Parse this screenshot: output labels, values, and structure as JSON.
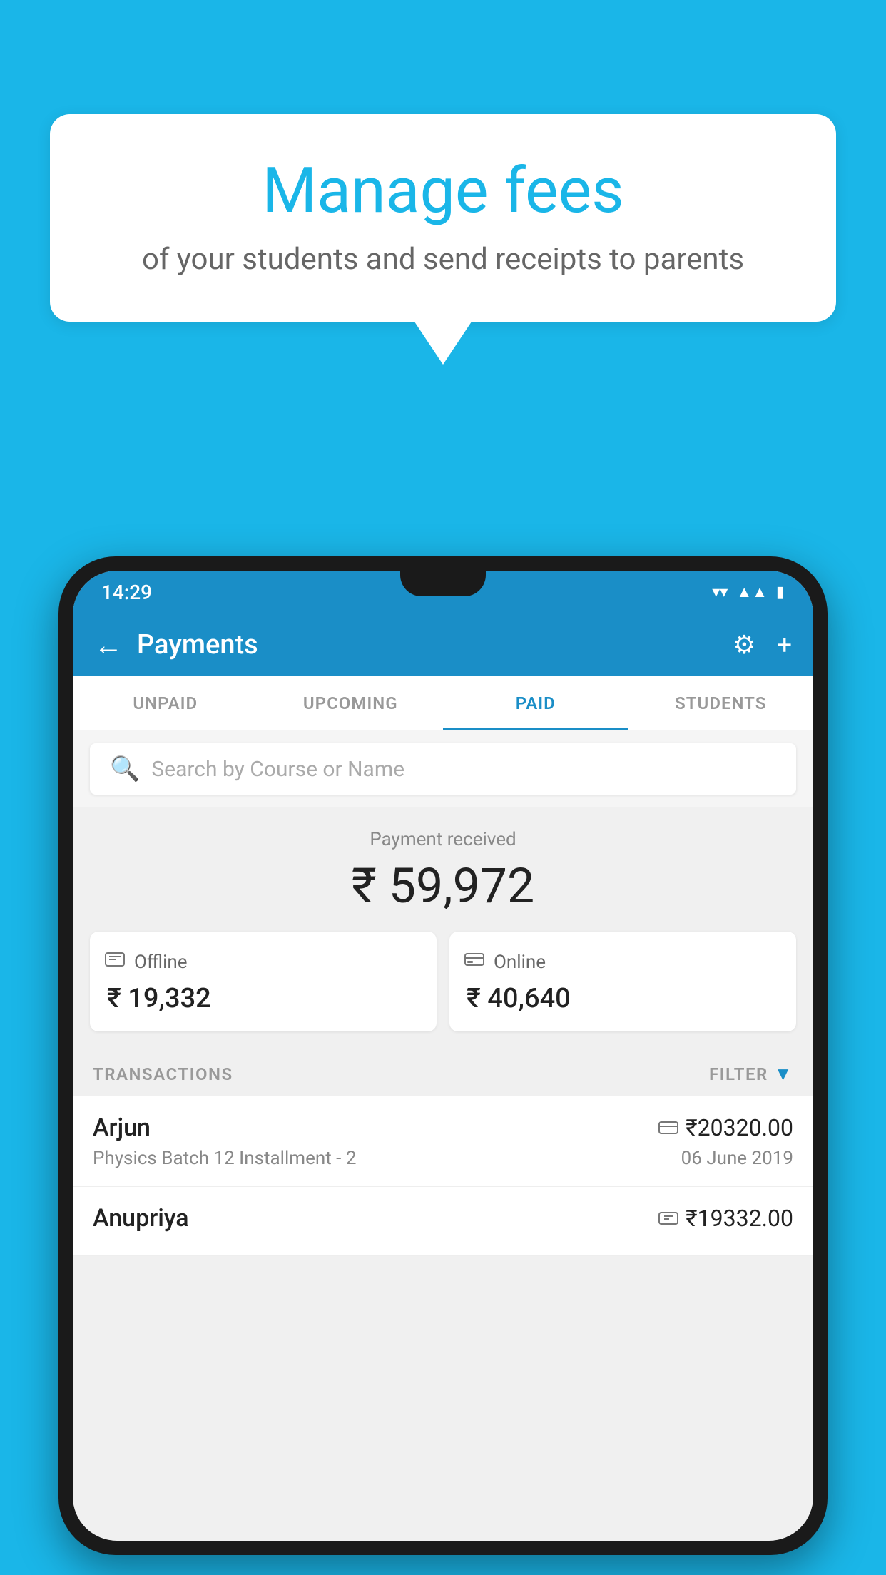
{
  "background_color": "#1ab6e8",
  "speech_bubble": {
    "title": "Manage fees",
    "subtitle": "of your students and send receipts to parents"
  },
  "phone": {
    "status_bar": {
      "time": "14:29",
      "wifi": "▼",
      "signal": "▲",
      "battery": "▮"
    },
    "app_bar": {
      "title": "Payments",
      "back_label": "←",
      "settings_label": "⚙",
      "add_label": "+"
    },
    "tabs": [
      {
        "label": "UNPAID",
        "active": false
      },
      {
        "label": "UPCOMING",
        "active": false
      },
      {
        "label": "PAID",
        "active": true
      },
      {
        "label": "STUDENTS",
        "active": false
      }
    ],
    "search": {
      "placeholder": "Search by Course or Name"
    },
    "payment_summary": {
      "label": "Payment received",
      "amount": "₹ 59,972",
      "offline": {
        "label": "Offline",
        "amount": "₹ 19,332"
      },
      "online": {
        "label": "Online",
        "amount": "₹ 40,640"
      }
    },
    "transactions": {
      "header_label": "TRANSACTIONS",
      "filter_label": "FILTER",
      "items": [
        {
          "name": "Arjun",
          "detail": "Physics Batch 12 Installment - 2",
          "amount": "₹20320.00",
          "date": "06 June 2019",
          "type": "online"
        },
        {
          "name": "Anupriya",
          "detail": "",
          "amount": "₹19332.00",
          "date": "",
          "type": "offline"
        }
      ]
    }
  }
}
